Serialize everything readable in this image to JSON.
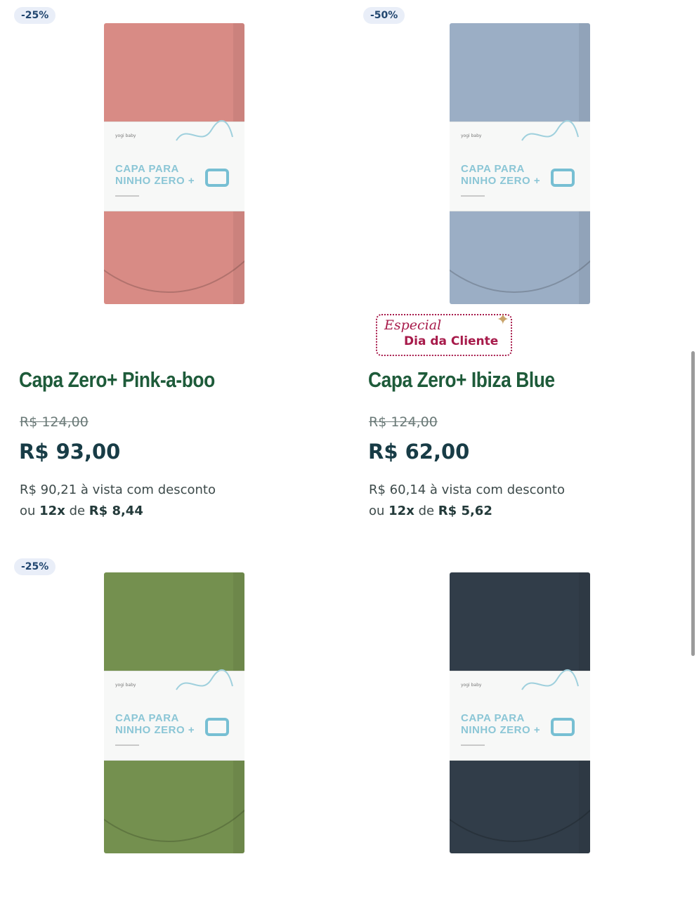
{
  "products": [
    {
      "discount": "-25%",
      "title": "Capa Zero+ Pink-a-boo",
      "old_price": "R$ 124,00",
      "price": "R$ 93,00",
      "cash_price": "R$ 90,21 à vista com desconto",
      "installments_prefix": "ou",
      "installments_count": "12x",
      "installments_middle": "de",
      "installment_value": "R$ 8,44",
      "fabric_color": "#d88b85",
      "band_text": "CAPA PARA NINHO ZERO +",
      "band_brand": "yogi baby"
    },
    {
      "discount": "-50%",
      "title": "Capa Zero+ Ibiza Blue",
      "old_price": "R$ 124,00",
      "price": "R$ 62,00",
      "cash_price": "R$ 60,14 à vista com desconto",
      "installments_prefix": "ou",
      "installments_count": "12x",
      "installments_middle": "de",
      "installment_value": "R$ 5,62",
      "fabric_color": "#9baec5",
      "band_text": "CAPA PARA NINHO ZERO +",
      "band_brand": "yogi baby"
    },
    {
      "discount": "-25%",
      "fabric_color": "#74904f",
      "band_text": "CAPA PARA NINHO ZERO +",
      "band_brand": "yogi baby"
    },
    {
      "fabric_color": "#313d49",
      "band_text": "CAPA PARA NINHO ZERO +",
      "band_brand": "yogi baby"
    }
  ],
  "promo": {
    "line1": "Especial",
    "line2": "Dia da Cliente",
    "color": "#a71a4a"
  }
}
